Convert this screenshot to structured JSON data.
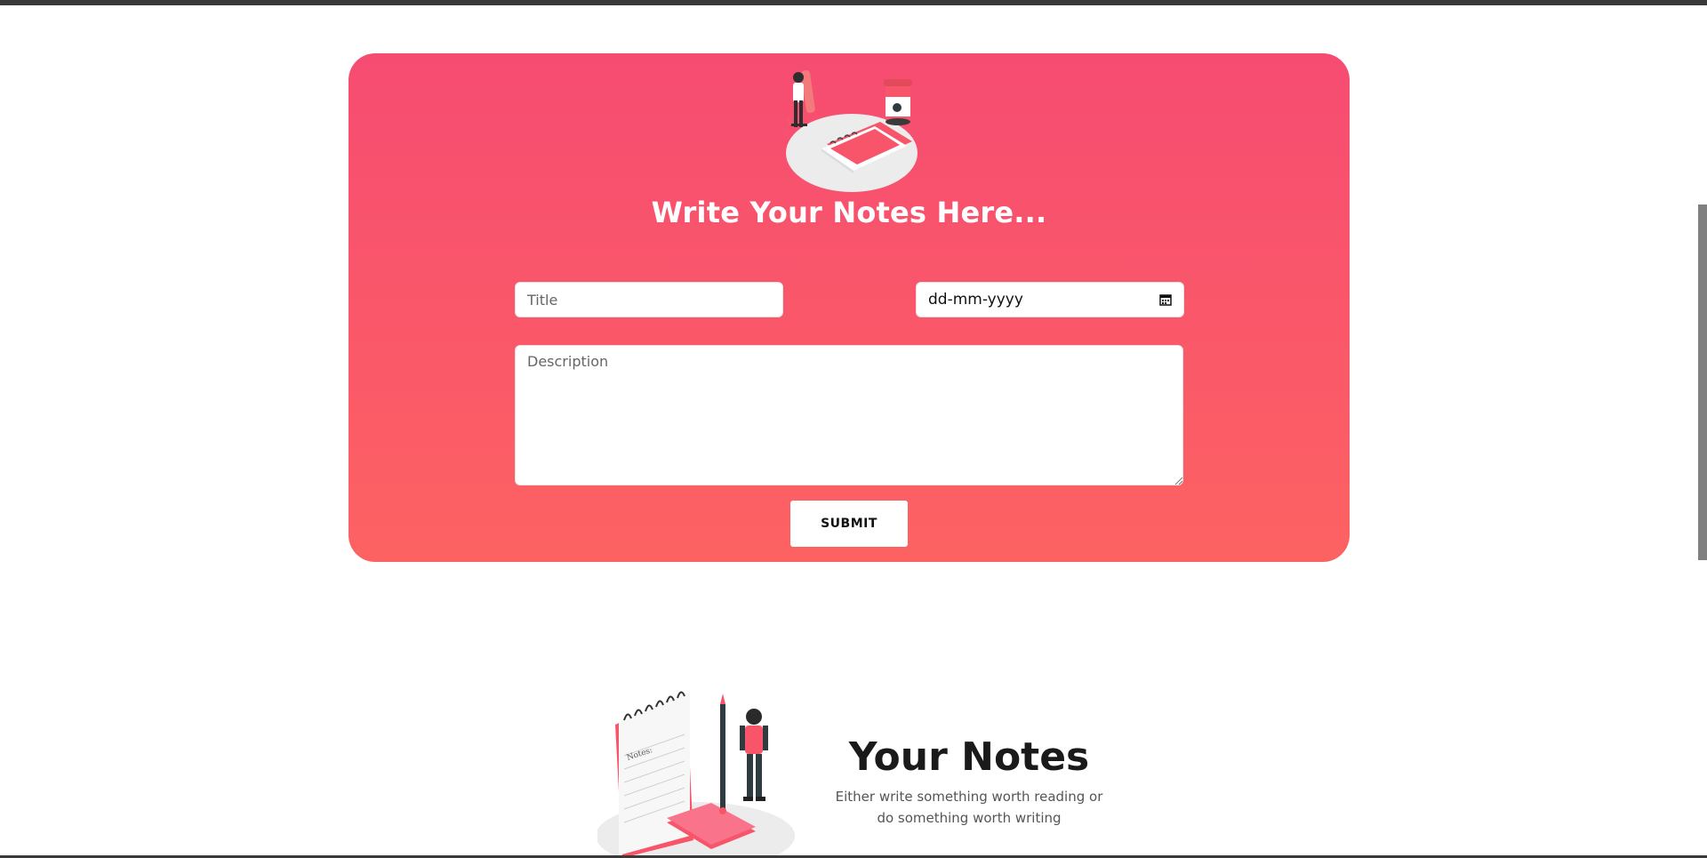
{
  "form": {
    "heading": "Write Your Notes Here...",
    "title_placeholder": "Title",
    "date_value": "dd-mm-yyyy",
    "description_placeholder": "Description",
    "submit_label": "SUBMIT"
  },
  "notes_section": {
    "heading": "Your Notes",
    "subtitle": "Either write something worth reading or do something worth writing"
  },
  "illustrations": {
    "hero_icon": "writing-notes-illustration",
    "notes_icon": "notepad-person-illustration",
    "notepad_header": "Notes:"
  },
  "colors": {
    "gradient_top": "#f64c72",
    "gradient_bottom": "#fd6262",
    "accent": "#f8556a"
  }
}
